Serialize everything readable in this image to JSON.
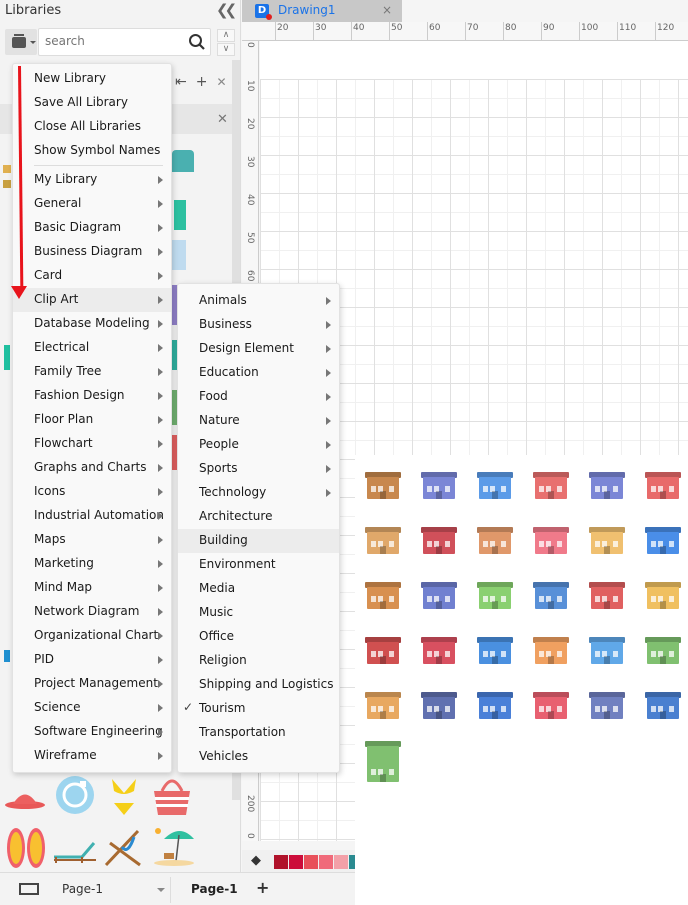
{
  "left_panel": {
    "title": "Libraries",
    "collapse_icon": "double-chevron-left-icon",
    "search": {
      "placeholder": "search",
      "value": ""
    },
    "library_actions": [
      "import-icon",
      "add-icon",
      "close-icon"
    ]
  },
  "tab": {
    "title": "Drawing1",
    "close": "×"
  },
  "ruler": {
    "top_labels": [
      "20",
      "30",
      "40",
      "50",
      "60",
      "70",
      "80",
      "90",
      "100",
      "110",
      "120"
    ],
    "left_labels": [
      "0",
      "10",
      "20",
      "30",
      "40",
      "50",
      "60"
    ],
    "left_bottom_labels": [
      "200",
      "0"
    ]
  },
  "main_menu": {
    "top_items": [
      "New Library",
      "Save All Library",
      "Close All Libraries",
      "Show Symbol Names"
    ],
    "category_items": [
      "My Library",
      "General",
      "Basic Diagram",
      "Business Diagram",
      "Card",
      "Clip Art",
      "Database Modeling",
      "Electrical",
      "Family Tree",
      "Fashion Design",
      "Floor Plan",
      "Flowchart",
      "Graphs and Charts",
      "Icons",
      "Industrial Automation",
      "Maps",
      "Marketing",
      "Mind Map",
      "Network Diagram",
      "Organizational Chart",
      "PID",
      "Project Management",
      "Science",
      "Software Engineering",
      "Wireframe"
    ],
    "highlighted": "Clip Art"
  },
  "sub_menu": {
    "items": [
      {
        "label": "Animals",
        "has_sub": true,
        "checked": false
      },
      {
        "label": "Business",
        "has_sub": true,
        "checked": false
      },
      {
        "label": "Design Element",
        "has_sub": true,
        "checked": false
      },
      {
        "label": "Education",
        "has_sub": true,
        "checked": false
      },
      {
        "label": "Food",
        "has_sub": true,
        "checked": false
      },
      {
        "label": "Nature",
        "has_sub": true,
        "checked": false
      },
      {
        "label": "People",
        "has_sub": true,
        "checked": false
      },
      {
        "label": "Sports",
        "has_sub": true,
        "checked": false
      },
      {
        "label": "Technology",
        "has_sub": true,
        "checked": false
      },
      {
        "label": "Architecture",
        "has_sub": false,
        "checked": false
      },
      {
        "label": "Building",
        "has_sub": false,
        "checked": false
      },
      {
        "label": "Environment",
        "has_sub": false,
        "checked": false
      },
      {
        "label": "Media",
        "has_sub": false,
        "checked": false
      },
      {
        "label": "Music",
        "has_sub": false,
        "checked": false
      },
      {
        "label": "Office",
        "has_sub": false,
        "checked": false
      },
      {
        "label": "Religion",
        "has_sub": false,
        "checked": false
      },
      {
        "label": "Shipping and Logistics",
        "has_sub": false,
        "checked": false
      },
      {
        "label": "Tourism",
        "has_sub": false,
        "checked": true
      },
      {
        "label": "Transportation",
        "has_sub": false,
        "checked": false
      },
      {
        "label": "Vehicles",
        "has_sub": false,
        "checked": false
      }
    ],
    "highlighted": "Building",
    "check_glyph": "✓"
  },
  "building_preview": {
    "count": 31,
    "colors": [
      "#c8884e",
      "#7b86d6",
      "#5b9be8",
      "#e8706f",
      "#7b86d6",
      "#e86a6a",
      "#e0a86a",
      "#d0505a",
      "#e0986a",
      "#f07a8a",
      "#f0c070",
      "#4a8ee8",
      "#d89050",
      "#7080d0",
      "#8ad070",
      "#5890d8",
      "#e06060",
      "#f0c060",
      "#d05050",
      "#d85060",
      "#4a90e0",
      "#f0a060",
      "#60a8e8",
      "#80c070",
      "#e8a860",
      "#6070b0",
      "#4a80d8",
      "#e86070",
      "#7080c0",
      "#4a80d0",
      "#80c070"
    ]
  },
  "tourism_symbols": [
    "hat-icon",
    "ring-buoy-icon",
    "bikini-icon",
    "beach-bag-icon",
    "flip-flops-icon",
    "sun-lounger-icon",
    "deck-chair-icon",
    "beach-umbrella-icon"
  ],
  "color_bar": {
    "fill_icon": "paint-bucket-icon",
    "swatches": [
      "#b0122a",
      "#cc0c3a",
      "#e8505a",
      "#f06a7a",
      "#f3a0a8",
      "#2a8a90"
    ]
  },
  "bottom_bar": {
    "page_select": "Page-1",
    "page_tab": "Page-1",
    "add_page": "+"
  },
  "annotation": {
    "arrow_color": "#e8141c"
  }
}
